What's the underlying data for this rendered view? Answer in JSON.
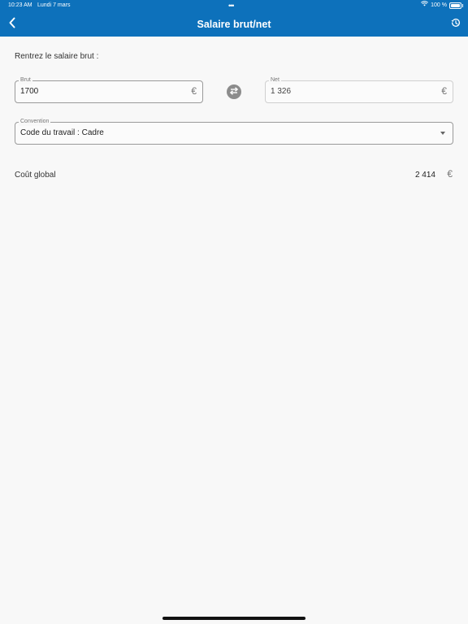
{
  "status": {
    "time": "10:23 AM",
    "date": "Lundi 7 mars",
    "dots": "•••",
    "battery": "100 %"
  },
  "header": {
    "title": "Salaire brut/net"
  },
  "form": {
    "prompt": "Rentrez le salaire brut :",
    "brut": {
      "label": "Brut",
      "value": "1700",
      "currency": "€"
    },
    "net": {
      "label": "Net",
      "value": "1 326",
      "currency": "€"
    },
    "convention": {
      "label": "Convention",
      "value": "Code du travail : Cadre"
    }
  },
  "result": {
    "label": "Coût global",
    "value": "2 414",
    "currency": "€"
  },
  "colors": {
    "header": "#0d71bb",
    "background": "#f8f8f8",
    "swap_button": "#8c8c8c"
  },
  "icons": {
    "back": "chevron-left-icon",
    "history": "history-icon",
    "swap": "swap-arrows-icon",
    "dropdown": "caret-down-icon",
    "wifi": "wifi-icon",
    "battery": "battery-icon"
  }
}
